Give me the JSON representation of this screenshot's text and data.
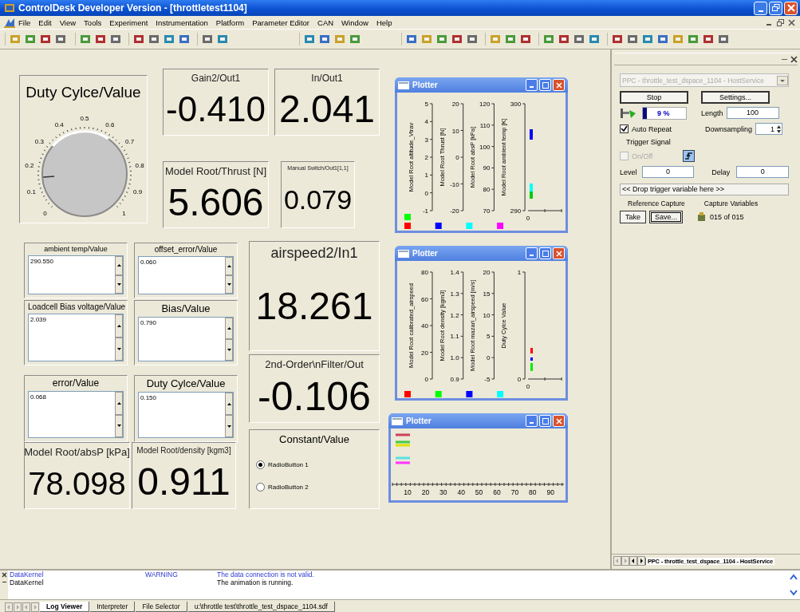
{
  "window": {
    "title": "ControlDesk Developer Version - [throttletest1104]"
  },
  "menu": [
    "File",
    "Edit",
    "View",
    "Tools",
    "Experiment",
    "Instrumentation",
    "Platform",
    "Parameter Editor",
    "CAN",
    "Window",
    "Help"
  ],
  "layout": {
    "knob": {
      "title": "Duty Cylce/Value",
      "ticks": [
        "0",
        "0.1",
        "0.2",
        "0.3",
        "0.4",
        "0.5",
        "0.6",
        "0.7",
        "0.8",
        "0.9",
        "1"
      ]
    },
    "displays": [
      {
        "label": "Gain2/Out1",
        "value": "-0.410"
      },
      {
        "label": "In/Out1",
        "value": "2.041"
      },
      {
        "label": "Model Root/Thrust [N]",
        "value": "5.606"
      },
      {
        "label": "Manual Switch/Out1[1,1]",
        "value": "0.079"
      },
      {
        "label": "airspeed2/In1",
        "value": "18.261"
      },
      {
        "label": "2nd-Order\\nFilter/Out",
        "value": "-0.106"
      },
      {
        "label": "Model Root/absP [kPa]",
        "value": "78.098"
      },
      {
        "label": "Model Root/density [kgm3]",
        "value": "0.911"
      }
    ],
    "edit_fields": [
      {
        "label": "ambient temp/Value",
        "value": "290.550"
      },
      {
        "label": "offset_error/Value",
        "value": "0.060"
      },
      {
        "label": "Loadcell Bias voltage/Value",
        "value": "2.039"
      },
      {
        "label": "Bias/Value",
        "value": "0.790"
      },
      {
        "label": "error/Value",
        "value": "0.068"
      },
      {
        "label": "Duty Cylce/Value",
        "value": "0.150"
      }
    ],
    "radio_group": {
      "label": "Constant/Value",
      "options": [
        {
          "label": "RadioButton 1",
          "selected": true
        },
        {
          "label": "RadioButton 2",
          "selected": false
        }
      ]
    }
  },
  "plotters": [
    {
      "title": "Plotter",
      "kind": "axes",
      "axes": [
        {
          "label": "Model Root altitude_Vtrav",
          "ticks": [
            "5",
            "4",
            "3",
            "2",
            "1",
            "0",
            "-1"
          ]
        },
        {
          "label": "Model Root Thrust [N]",
          "ticks": [
            "20",
            "10",
            "0",
            "-10",
            "-20"
          ]
        },
        {
          "label": "Model Root absP [kPa]",
          "ticks": [
            "120",
            "110",
            "100",
            "90",
            "80",
            "70"
          ]
        },
        {
          "label": "Model Root ambient temp [K]",
          "ticks": [
            "300",
            "290"
          ]
        }
      ],
      "x_ticks": [
        "0"
      ],
      "legend": [
        [
          {
            "color": "#00ff00"
          },
          {
            "color": "#ff0000"
          }
        ],
        [
          {
            "color": "#0000ff"
          }
        ],
        [
          {
            "color": "#00ffff"
          }
        ],
        [
          {
            "color": "#ff00ff"
          }
        ]
      ]
    },
    {
      "title": "Plotter",
      "kind": "axes",
      "axes": [
        {
          "label": "Model Root calibrated_airspeed",
          "ticks": [
            "80",
            "60",
            "40",
            "20",
            "0"
          ]
        },
        {
          "label": "Model Root density [kgm3]",
          "ticks": [
            "1.4",
            "1.3",
            "1.2",
            "1.1",
            "1.0",
            "0.9"
          ]
        },
        {
          "label": "Model Root mazari_airspeed [m/s]",
          "ticks": [
            "20",
            "15",
            "10",
            "5",
            "0",
            "-5"
          ]
        },
        {
          "label": "Duty Cylce Value",
          "ticks": [
            "1",
            "0"
          ]
        }
      ],
      "x_ticks": [
        "0"
      ],
      "legend": [
        [
          {
            "color": "#ff0000"
          }
        ],
        [
          {
            "color": "#00ff00"
          }
        ],
        [
          {
            "color": "#0000ff"
          }
        ],
        [
          {
            "color": "#00ffff"
          }
        ]
      ]
    },
    {
      "title": "Plotter",
      "kind": "time",
      "x_ticks": [
        "10",
        "20",
        "30",
        "40",
        "50",
        "60",
        "70",
        "80",
        "90"
      ],
      "traces": [
        {
          "color": "#d0405a"
        },
        {
          "color": "#44cc44"
        },
        {
          "color": "#e0e000"
        },
        {
          "color": "#5de0e0"
        },
        {
          "color": "#ff33ff"
        }
      ]
    }
  ],
  "capture": {
    "platform": "PPC - throttle_test_dspace_1104 - HostService",
    "stop": "Stop",
    "settings": "Settings...",
    "progress": {
      "text": "9 %",
      "level": 0.09
    },
    "length_label": "Length",
    "length": "100",
    "auto_repeat": {
      "label": "Auto Repeat",
      "checked": true
    },
    "downsampling_label": "Downsampling",
    "downsampling": "1",
    "trigger_group": "Trigger Signal",
    "trigger_switch": {
      "label": "On/Off",
      "checked": false,
      "disabled": true
    },
    "trigger_level_label": "Level",
    "trigger_level": "0",
    "delay_label": "Delay",
    "delay": "0",
    "drop_hint": "<< Drop trigger variable here >>",
    "reference_label": "Reference Capture",
    "take": "Take",
    "save": "Save...",
    "variables_label": "Capture Variables",
    "variables_count": "015 of 015"
  },
  "side_tabs": [
    {
      "label": "PPC - throttle_test_dspace_1104 - HostService",
      "selected": true
    }
  ],
  "log": [
    {
      "kind": "warning",
      "source": "DataKernel",
      "level_text": "WARNING",
      "message": "The data connection is not valid."
    },
    {
      "kind": "info",
      "source": "DataKernel",
      "message": "The animation is running."
    }
  ],
  "bottom_tabs": [
    {
      "label": "Log Viewer",
      "selected": true
    },
    {
      "label": "Interpreter",
      "selected": false
    },
    {
      "label": "File Selector",
      "selected": false
    },
    {
      "label": "u:\\throttle test\\throttle_test_dspace_1104.sdf",
      "selected": false
    }
  ]
}
